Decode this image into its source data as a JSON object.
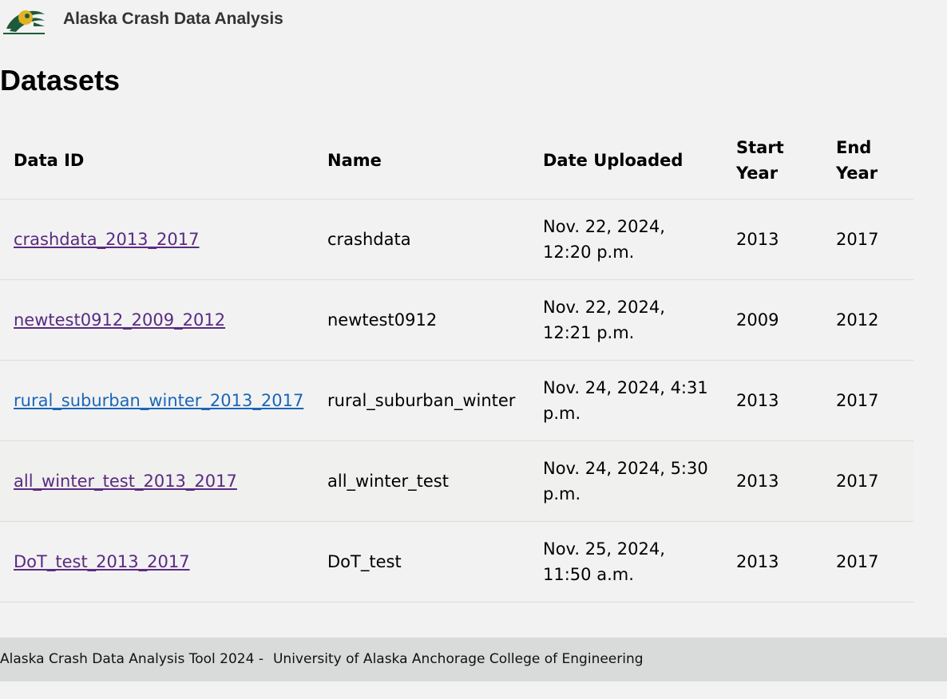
{
  "header": {
    "app_title": "Alaska Crash Data Analysis",
    "logo_icon": "alaska-native-bird-logo-icon"
  },
  "page": {
    "title": "Datasets"
  },
  "table": {
    "columns": [
      "Data ID",
      "Name",
      "Date Uploaded",
      "Start Year",
      "End Year"
    ],
    "rows": [
      {
        "data_id": "crashdata_2013_2017",
        "name": "crashdata",
        "date_uploaded": "Nov. 22, 2024, 12:20 p.m.",
        "start_year": "2013",
        "end_year": "2017"
      },
      {
        "data_id": "newtest0912_2009_2012",
        "name": "newtest0912",
        "date_uploaded": "Nov. 22, 2024, 12:21 p.m.",
        "start_year": "2009",
        "end_year": "2012"
      },
      {
        "data_id": "rural_suburban_winter_2013_2017",
        "name": "rural_suburban_winter",
        "date_uploaded": "Nov. 24, 2024, 4:31 p.m.",
        "start_year": "2013",
        "end_year": "2017"
      },
      {
        "data_id": "all_winter_test_2013_2017",
        "name": "all_winter_test",
        "date_uploaded": "Nov. 24, 2024, 5:30 p.m.",
        "start_year": "2013",
        "end_year": "2017"
      },
      {
        "data_id": "DoT_test_2013_2017",
        "name": "DoT_test",
        "date_uploaded": "Nov. 25, 2024, 11:50 a.m.",
        "start_year": "2013",
        "end_year": "2017"
      }
    ]
  },
  "footer": {
    "left": "Alaska Crash Data Analysis Tool 2024 -",
    "right": "University of Alaska Anchorage College of Engineering"
  },
  "colors": {
    "background": "#f2f2f2",
    "visited_link": "#5a2a82",
    "active_link": "#1a66b8",
    "footer_bg": "#d9dbda",
    "logo_green": "#1e5a3a",
    "logo_gold": "#e0b323"
  }
}
